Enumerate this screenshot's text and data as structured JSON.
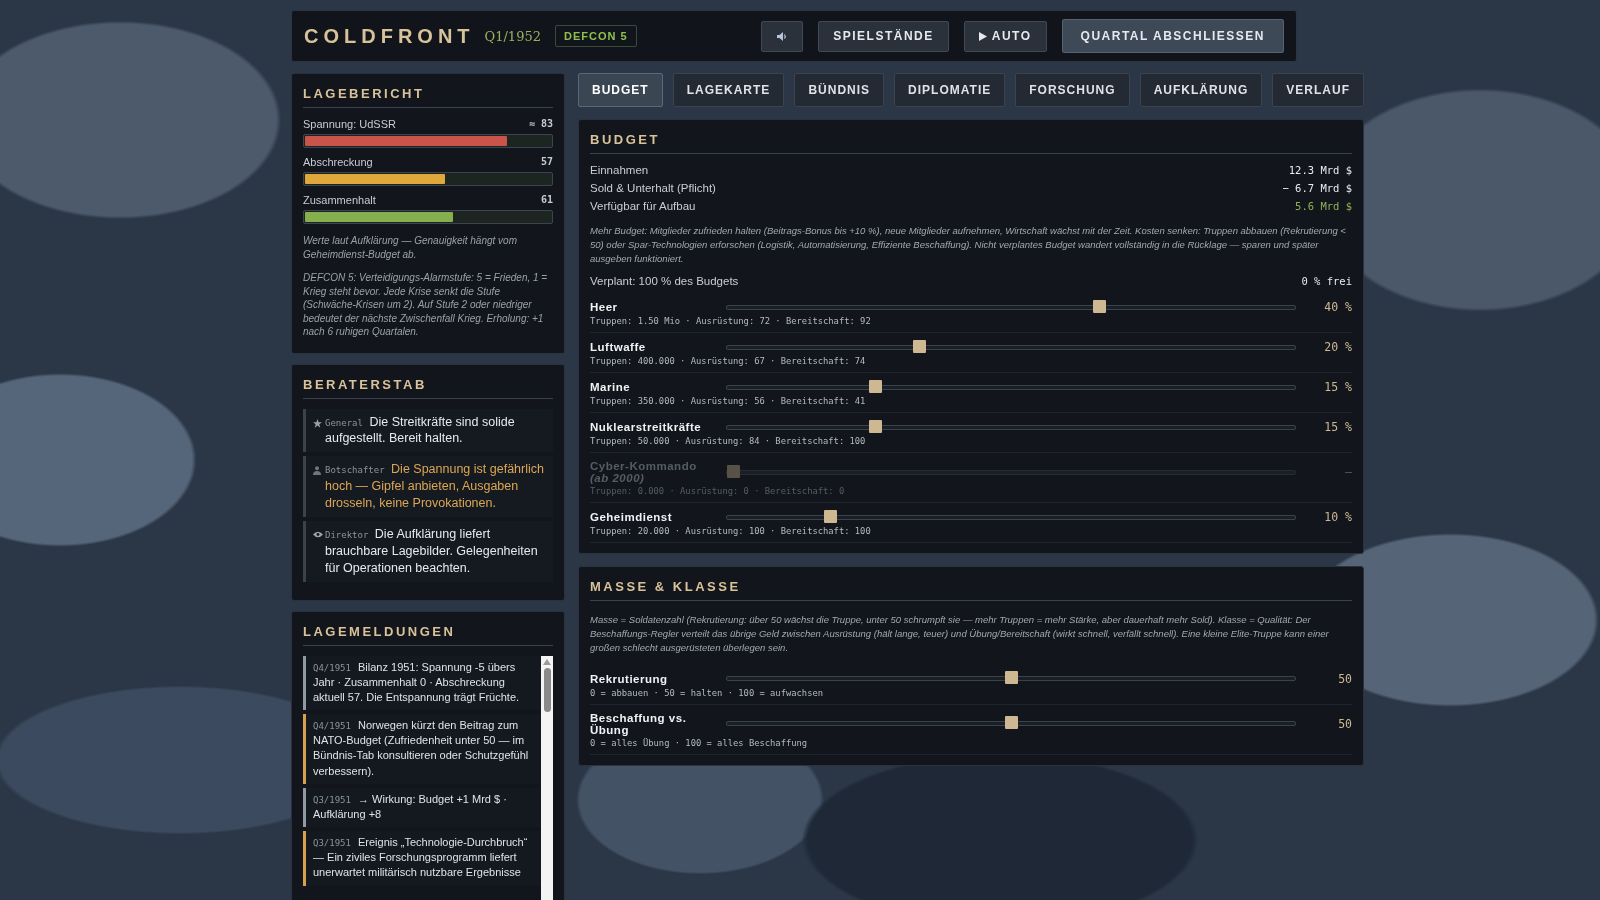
{
  "header": {
    "title": "COLDFRONT",
    "quarter": "Q1/1952",
    "defcon": "DEFCON 5",
    "buttons": [
      {
        "kind": "sound"
      },
      {
        "kind": "text",
        "label": "SPIELSTÄNDE"
      },
      {
        "kind": "play",
        "label": "AUTO"
      },
      {
        "kind": "primary",
        "label": "QUARTAL ABSCHLIESSEN"
      }
    ]
  },
  "lagebericht": {
    "title": "LAGEBERICHT",
    "meters": [
      {
        "label": "Spannung: UdSSR",
        "value": "≈ 83",
        "level": 0.82,
        "color": "#c9544a"
      },
      {
        "label": "Abschreckung",
        "value": "57",
        "level": 0.57,
        "color": "#e0a83a"
      },
      {
        "label": "Zusammenhalt",
        "value": "61",
        "level": 0.6,
        "color": "#86b04e"
      }
    ],
    "notes": [
      "Werte laut Aufklärung — Genauigkeit hängt vom Geheimdienst-Budget ab.",
      "DEFCON 5: Verteidigungs-Alarmstufe: 5 = Frieden, 1 = Krieg steht bevor. Jede Krise senkt die Stufe (Schwäche-Krisen um 2). Auf Stufe 2 oder niedriger bedeutet der nächste Zwischenfall Krieg. Erholung: +1 nach 6 ruhigen Quartalen."
    ]
  },
  "beraterstab": {
    "title": "BERATERSTAB",
    "advisors": [
      {
        "role": "General",
        "text": "Die Streitkräfte sind solide aufgestellt. Bereit halten.",
        "kind": "normal"
      },
      {
        "role": "Botschafter",
        "text": "Die Spannung ist gefährlich hoch — Gipfel anbieten, Ausgaben drosseln, keine Provokationen.",
        "kind": "warning"
      },
      {
        "role": "Direktor",
        "text": "Die Aufklärung liefert brauchbare Lagebilder. Gelegenheiten für Operationen beachten.",
        "kind": "normal"
      }
    ]
  },
  "lagemeldungen": {
    "title": "LAGEMELDUNGEN",
    "entries": [
      {
        "date": "Q4/1951",
        "text": "Bilanz 1951: Spannung -5 übers Jahr · Zusammenhalt 0 · Abschreckung aktuell 57. Die Entspannung trägt Früchte.",
        "color": "#8f9aa3"
      },
      {
        "date": "Q4/1951",
        "text": "Norwegen kürzt den Beitrag zum NATO-Budget (Zufriedenheit unter 50 — im Bündnis-Tab konsultieren oder Schutzgefühl verbessern).",
        "color": "#d9a04a"
      },
      {
        "date": "Q3/1951",
        "text": "→ Wirkung: Budget +1 Mrd $ · Aufklärung +8",
        "color": "#8f9aa3"
      },
      {
        "date": "Q3/1951",
        "text": "Ereignis „Technologie-Durchbruch“ — Ein ziviles Forschungsprogramm liefert unerwartet militärisch nutzbare Ergebnisse",
        "color": "#d9a04a"
      }
    ]
  },
  "tabs": [
    {
      "label": "BUDGET",
      "selected": true
    },
    {
      "label": "LAGEKARTE",
      "selected": false
    },
    {
      "label": "BÜNDNIS",
      "selected": false
    },
    {
      "label": "DIPLOMATIE",
      "selected": false
    },
    {
      "label": "FORSCHUNG",
      "selected": false
    },
    {
      "label": "AUFKLÄRUNG",
      "selected": false
    },
    {
      "label": "VERLAUF",
      "selected": false
    }
  ],
  "budget": {
    "title": "BUDGET",
    "lines": [
      {
        "label": "Einnahmen",
        "value": "12.3 Mrd $",
        "kind": "plain"
      },
      {
        "label": "Sold & Unterhalt (Pflicht)",
        "value": "− 6.7 Mrd $",
        "kind": "plain"
      },
      {
        "label": "Verfügbar für Aufbau",
        "value": "5.6 Mrd $",
        "kind": "positive"
      }
    ],
    "note": "Mehr Budget: Mitglieder zufrieden halten (Beitrags-Bonus bis +10 %), neue Mitglieder aufnehmen, Wirtschaft wächst mit der Zeit. Kosten senken: Truppen abbauen (Rekrutierung < 50) oder Spar-Technologien erforschen (Logistik, Automatisierung, Effiziente Beschaffung). Nicht verplantes Budget wandert vollständig in die Rücklage — sparen und später ausgeben funktioniert.",
    "planned": "Verplant: 100 % des Budgets",
    "free": "0 % frei",
    "branches": [
      {
        "name": "Heer",
        "value": "40 %",
        "level": 0.66,
        "stats": "Truppen: 1.50 Mio · Ausrüstung: 72 · Bereitschaft: 92",
        "disabled": false
      },
      {
        "name": "Luftwaffe",
        "value": "20 %",
        "level": 0.336,
        "stats": "Truppen: 400.000 · Ausrüstung: 67 · Bereitschaft: 74",
        "disabled": false
      },
      {
        "name": "Marine",
        "value": "15 %",
        "level": 0.255,
        "stats": "Truppen: 350.000 · Ausrüstung: 56 · Bereitschaft: 41",
        "disabled": false
      },
      {
        "name": "Nuklearstreitkräfte",
        "value": "15 %",
        "level": 0.255,
        "stats": "Truppen: 50.000 · Ausrüstung: 84 · Bereitschaft: 100",
        "disabled": false
      },
      {
        "name": "Cyber-Kommando",
        "sub": "(ab 2000)",
        "value": "—",
        "level": 0,
        "stats": "Truppen: 0.000 · Ausrüstung: 0 · Bereitschaft: 0",
        "disabled": true
      },
      {
        "name": "Geheimdienst",
        "value": "10 %",
        "level": 0.175,
        "stats": "Truppen: 20.000 · Ausrüstung: 100 · Bereitschaft: 100",
        "disabled": false
      }
    ]
  },
  "masse": {
    "title": "MASSE & KLASSE",
    "note": "Masse = Soldatenzahl (Rekrutierung: über 50 wächst die Truppe, unter 50 schrumpft sie — mehr Truppen = mehr Stärke, aber dauerhaft mehr Sold). Klasse = Qualität: Der Beschaffungs-Regler verteilt das übrige Geld zwischen Ausrüstung (hält lange, teuer) und Übung/Bereitschaft (wirkt schnell, verfällt schnell). Eine kleine Elite-Truppe kann einer großen schlecht ausgerüsteten überlegen sein.",
    "sliders": [
      {
        "name": "Rekrutierung",
        "value": "50",
        "level": 0.5,
        "hint": "0 = abbauen · 50 = halten · 100 = aufwachsen"
      },
      {
        "name": "Beschaffung vs. Übung",
        "value": "50",
        "level": 0.5,
        "hint": "0 = alles Übung · 100 = alles Beschaffung"
      }
    ]
  }
}
